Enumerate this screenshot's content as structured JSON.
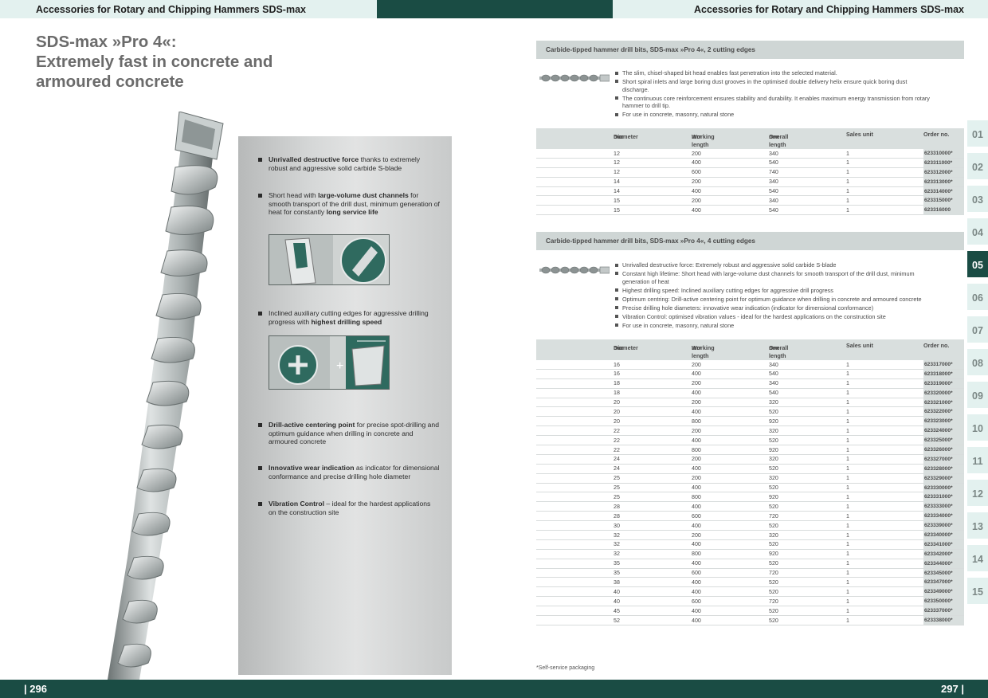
{
  "header": {
    "left_title": "Accessories for Rotary and Chipping Hammers SDS-max",
    "right_title": "Accessories for Rotary and Chipping Hammers SDS-max"
  },
  "footer": {
    "page_left": "| 296",
    "page_right": "297 |"
  },
  "title": {
    "line1": "SDS-max »Pro 4«:",
    "line2": "Extremely fast in concrete and",
    "line3": "armoured concrete"
  },
  "features": [
    {
      "bold": "Unrivalled destructive force",
      "rest": " thanks to extremely robust and aggressive solid carbide S-blade"
    },
    {
      "pre": "Short head with ",
      "bold": "large-volume dust channels",
      "mid": " for smooth transport of the drill dust, minimum generation of heat for constantly ",
      "bold2": "long service life"
    },
    {
      "pre": "Inclined auxiliary cutting edges for aggressive drilling progress with ",
      "bold": "highest drilling speed"
    },
    {
      "bold": "Drill-active centering point",
      "rest": " for precise spot-drilling and optimum guidance when drilling in concrete and armoured concrete"
    },
    {
      "bold": "Innovative wear indication",
      "rest": " as indicator for dimensional conformance and precise drilling hole diameter"
    },
    {
      "bold": "Vibration Control",
      "rest": " – ideal for the hardest applications on the construction site"
    }
  ],
  "section1": {
    "title": "Carbide-tipped hammer drill bits, SDS-max »Pro 4«, 2 cutting edges",
    "bullets": [
      "The slim, chisel-shaped bit head enables fast penetration into the selected material.",
      "Short spiral inlets and large boring dust grooves in the optimised double delivery helix ensure quick boring dust discharge.",
      "The continuous core reinforcement ensures stability and durability. It enables maximum energy transmission from rotary hammer to drill tip.",
      "For use in concrete, masonry, natural stone"
    ],
    "headers": [
      {
        "l1": "Diameter",
        "l2": "mm"
      },
      {
        "l1": "Working length",
        "l2": "mm"
      },
      {
        "l1": "Overall length",
        "l2": "mm"
      },
      {
        "l1": "Sales unit",
        "l2": ""
      },
      {
        "l1": "Order no.",
        "l2": ""
      }
    ],
    "rows": [
      [
        "12",
        "200",
        "340",
        "1",
        "623310000*"
      ],
      [
        "12",
        "400",
        "540",
        "1",
        "623311000*"
      ],
      [
        "12",
        "600",
        "740",
        "1",
        "623312000*"
      ],
      [
        "14",
        "200",
        "340",
        "1",
        "623313000*"
      ],
      [
        "14",
        "400",
        "540",
        "1",
        "623314000*"
      ],
      [
        "15",
        "200",
        "340",
        "1",
        "623315000*"
      ],
      [
        "15",
        "400",
        "540",
        "1",
        "623316000"
      ]
    ]
  },
  "section2": {
    "title": "Carbide-tipped hammer drill bits, SDS-max »Pro 4«, 4 cutting edges",
    "bullets": [
      "Unrivalled destructive force: Extremely robust and aggressive solid carbide S-blade",
      "Constant high lifetime: Short head with large-volume dust channels for smooth transport of the drill dust, minimum generation of heat",
      "Highest drilling speed: Inclined auxiliary cutting edges for aggressive drill progress",
      "Optimum centring: Drill-active centering point for optimum guidance when drilling in concrete and armoured concrete",
      "Precise drilling hole diameters: innovative wear indication (indicator for dimensional conformance)",
      "Vibration Control: optimised vibration values - ideal for the hardest applications on the construction site",
      "For use in concrete, masonry, natural stone"
    ],
    "headers": [
      {
        "l1": "Diameter",
        "l2": "mm"
      },
      {
        "l1": "Working length",
        "l2": "mm"
      },
      {
        "l1": "Overall length",
        "l2": "mm"
      },
      {
        "l1": "Sales unit",
        "l2": ""
      },
      {
        "l1": "Order no.",
        "l2": ""
      }
    ],
    "rows": [
      [
        "16",
        "200",
        "340",
        "1",
        "623317000*"
      ],
      [
        "16",
        "400",
        "540",
        "1",
        "623318000*"
      ],
      [
        "18",
        "200",
        "340",
        "1",
        "623319000*"
      ],
      [
        "18",
        "400",
        "540",
        "1",
        "623320000*"
      ],
      [
        "20",
        "200",
        "320",
        "1",
        "623321000*"
      ],
      [
        "20",
        "400",
        "520",
        "1",
        "623322000*"
      ],
      [
        "20",
        "800",
        "920",
        "1",
        "623323000*"
      ],
      [
        "22",
        "200",
        "320",
        "1",
        "623324000*"
      ],
      [
        "22",
        "400",
        "520",
        "1",
        "623325000*"
      ],
      [
        "22",
        "800",
        "920",
        "1",
        "623326000*"
      ],
      [
        "24",
        "200",
        "320",
        "1",
        "623327000*"
      ],
      [
        "24",
        "400",
        "520",
        "1",
        "623328000*"
      ],
      [
        "25",
        "200",
        "320",
        "1",
        "623329000*"
      ],
      [
        "25",
        "400",
        "520",
        "1",
        "623330000*"
      ],
      [
        "25",
        "800",
        "920",
        "1",
        "623331000*"
      ],
      [
        "28",
        "400",
        "520",
        "1",
        "623333000*"
      ],
      [
        "28",
        "600",
        "720",
        "1",
        "623334000*"
      ],
      [
        "30",
        "400",
        "520",
        "1",
        "623339000*"
      ],
      [
        "32",
        "200",
        "320",
        "1",
        "623340000*"
      ],
      [
        "32",
        "400",
        "520",
        "1",
        "623341000*"
      ],
      [
        "32",
        "800",
        "920",
        "1",
        "623342000*"
      ],
      [
        "35",
        "400",
        "520",
        "1",
        "623344000*"
      ],
      [
        "35",
        "600",
        "720",
        "1",
        "623345000*"
      ],
      [
        "38",
        "400",
        "520",
        "1",
        "623347000*"
      ],
      [
        "40",
        "400",
        "520",
        "1",
        "623349000*"
      ],
      [
        "40",
        "600",
        "720",
        "1",
        "623350000*"
      ],
      [
        "45",
        "400",
        "520",
        "1",
        "623337000*"
      ],
      [
        "52",
        "400",
        "520",
        "1",
        "623338000*"
      ]
    ]
  },
  "footnote": "*Self-service packaging",
  "tabs": [
    "01",
    "02",
    "03",
    "04",
    "05",
    "06",
    "07",
    "08",
    "09",
    "10",
    "11",
    "12",
    "13",
    "14",
    "15"
  ],
  "active_tab": "05",
  "colors": {
    "brand_dark": "#1a4c44",
    "band_light": "#e3f1ef",
    "table_header": "#d9dfde"
  }
}
